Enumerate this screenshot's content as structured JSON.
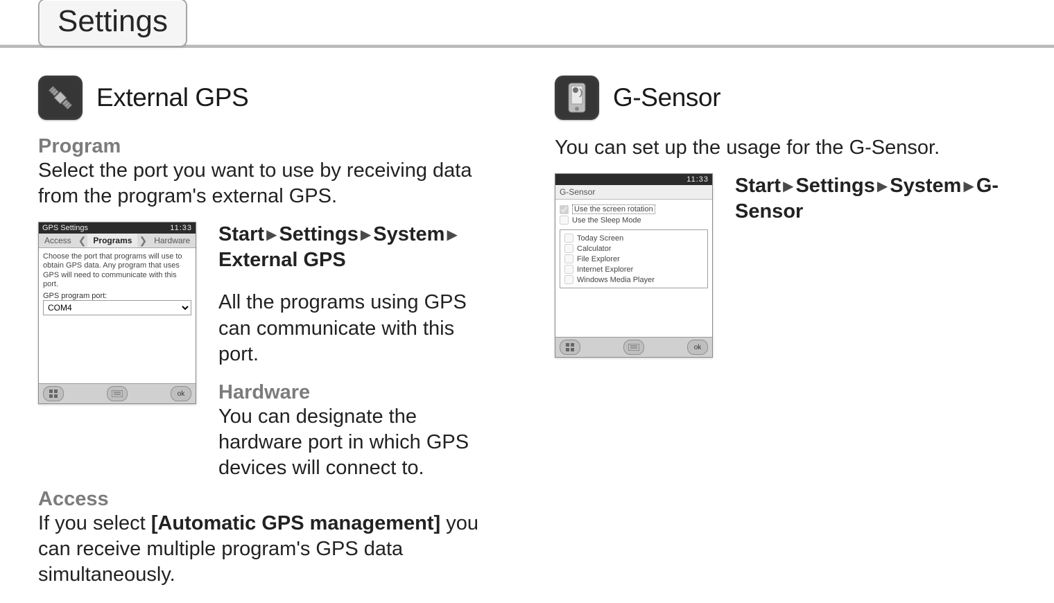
{
  "pageTab": "Settings",
  "left": {
    "sectionTitle": "External GPS",
    "program": {
      "heading": "Program",
      "desc": "Select the port you want to use by receiving data from the program's external GPS."
    },
    "pathSegments": [
      "Start",
      "Settings",
      "System",
      "External GPS"
    ],
    "desc2": "All the programs using GPS can communicate with this port.",
    "hardware": {
      "heading": "Hardware",
      "desc": "You can designate the hardware port in which GPS devices will connect to."
    },
    "access": {
      "heading": "Access",
      "lead": "If you select ",
      "bold": "[Automatic GPS management]",
      "tail": " you can receive multiple program's GPS data simultaneously."
    },
    "device": {
      "title": "GPS Settings",
      "status": "11:33",
      "tabs": {
        "left": "Access",
        "center": "Programs",
        "right": "Hardware"
      },
      "paragraph": "Choose the port that programs will use to obtain GPS data. Any program that uses GPS will need to communicate with this port.",
      "fieldLabel": "GPS program port:",
      "fieldValue": "COM4",
      "ok": "ok"
    }
  },
  "right": {
    "sectionTitle": "G-Sensor",
    "intro": "You can set up the usage for the G-Sensor.",
    "pathSegments": [
      "Start",
      "Settings",
      "System",
      "G-Sensor"
    ],
    "device": {
      "status": "11:33",
      "plainTitle": "G-Sensor",
      "ok": "ok",
      "checks": [
        {
          "label": "Use the screen rotation",
          "checked": true
        },
        {
          "label": "Use the Sleep Mode",
          "checked": false
        }
      ],
      "group": [
        "Today Screen",
        "Calculator",
        "File Explorer",
        "Internet Explorer",
        "Windows Media Player"
      ]
    }
  }
}
